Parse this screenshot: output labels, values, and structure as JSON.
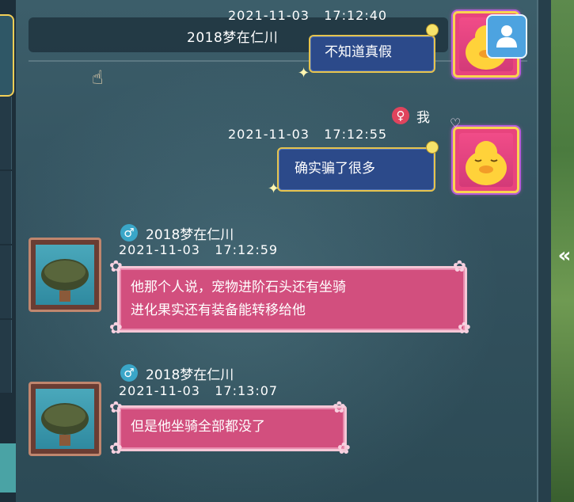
{
  "header": {
    "channel_name": "2018梦在仁川",
    "user_icon": "user-icon"
  },
  "messages": [
    {
      "side": "right",
      "sender": "",
      "gender": "",
      "timestamp": "2021-11-03   17:12:40",
      "text": "不知道真假",
      "avatar": "yellow-duck"
    },
    {
      "side": "right",
      "sender": "我",
      "gender": "female",
      "timestamp": "2021-11-03   17:12:55",
      "text": "确实骗了很多",
      "avatar": "yellow-duck"
    },
    {
      "side": "left",
      "sender": "2018梦在仁川",
      "gender": "male",
      "timestamp": "2021-11-03   17:12:59",
      "line1": "他那个人说，宠物进阶石头还有坐骑",
      "line2": "进化果实还有装备能转移给他",
      "avatar": "turtle"
    },
    {
      "side": "left",
      "sender": "2018梦在仁川",
      "gender": "male",
      "timestamp": "2021-11-03   17:13:07",
      "text": "但是他坐骑全部都没了",
      "avatar": "turtle"
    }
  ],
  "symbols": {
    "male": "♂",
    "female": "♀",
    "collapse": "«"
  },
  "colors": {
    "blue_bubble": "#2c4a8a",
    "pink_bubble": "#d24f7e",
    "gold_border": "#e6c34d"
  }
}
